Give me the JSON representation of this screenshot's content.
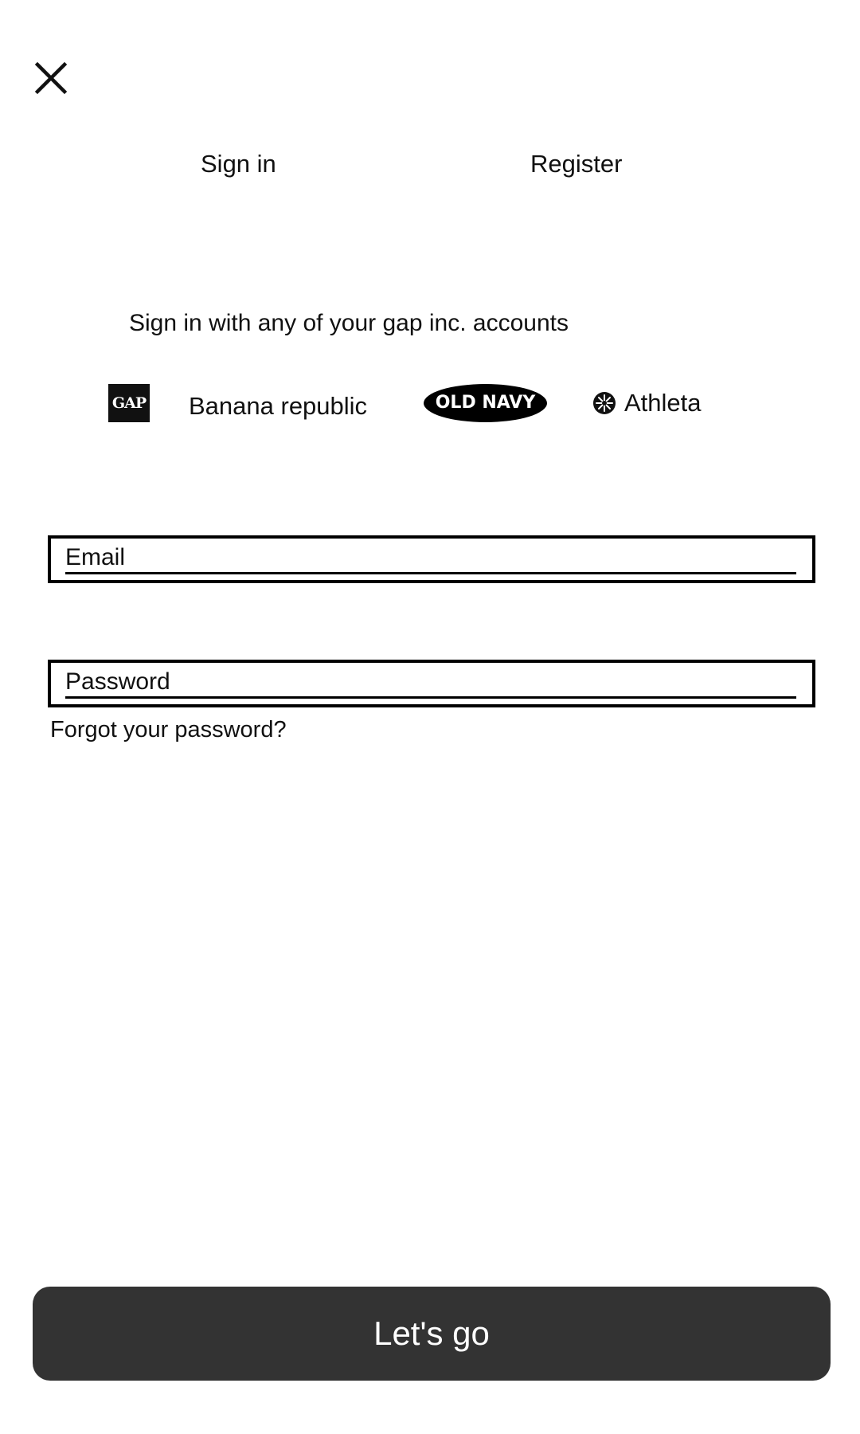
{
  "header": {
    "close_icon": "close-icon"
  },
  "tabs": {
    "sign_in": "Sign in",
    "register": "Register"
  },
  "subtitle": "Sign in with any of your gap inc. accounts",
  "brands": {
    "gap": "GAP",
    "banana_republic": "Banana republic",
    "old_navy": "OLD NAVY",
    "athleta": "Athleta",
    "athleta_icon": "athleta-logo-icon"
  },
  "form": {
    "email_placeholder": "Email",
    "email_value": "",
    "password_placeholder": "Password",
    "password_value": "",
    "forgot_label": "Forgot your password?",
    "submit_label": "Let's go"
  },
  "colors": {
    "button_background": "#333333",
    "button_text": "#ffffff",
    "field_border": "#000000",
    "text": "#111111"
  }
}
